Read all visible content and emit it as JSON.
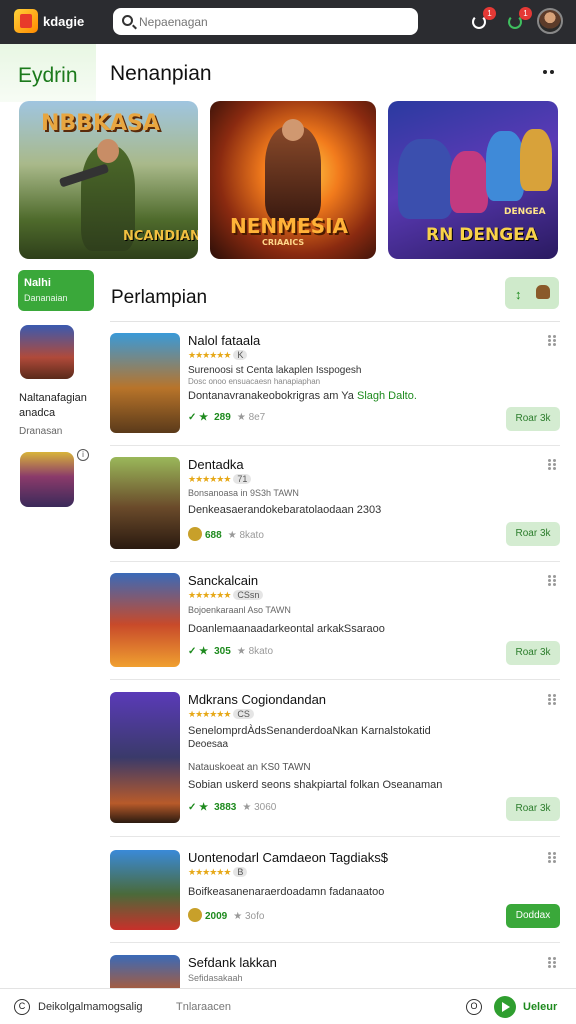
{
  "colors": {
    "topbar": "#2b2c30",
    "accent": "#3aa83a",
    "accent_light": "#d4ecd1",
    "star": "#e6a817"
  },
  "topbar": {
    "logo_text": "kdagie",
    "search_value": "",
    "search_placeholder": "Nepaenagan",
    "notif_1_count": "1",
    "notif_2_count": "1"
  },
  "featured": {
    "tab_label": "Eydrin",
    "title": "Nenanpian",
    "banners": [
      {
        "title": "NBBKASA",
        "subtitle": "NCANDIAN"
      },
      {
        "title": "NENMESIA",
        "subtitle": "CRIAAICS"
      },
      {
        "title": "RN DENGEA",
        "subtitle": "DENGEA"
      }
    ]
  },
  "sidebar": {
    "category_title": "Nalhi",
    "category_sub": "Dananaian",
    "item_name": "Naltanafagian anadca",
    "item_sub": "Dranasan"
  },
  "list": {
    "title": "Perlampian",
    "items": [
      {
        "name": "Nalol fataala",
        "rating_tag": "K",
        "subtitle": "Surenoosi st Centa lakaplen Isspogesh",
        "subtitle2": "Dosc onoo ensuacaesn hanapiaphan",
        "desc": "Dontanavranakeobokrigras am Ya",
        "desc_highlight": "Slagh Dalto.",
        "stat_a": "289",
        "stat_b": "8e7",
        "action": "Roar 3k"
      },
      {
        "name": "Dentadka",
        "rating_tag": "71",
        "subtitle": "Bonsanoasa in 9S3h TAWN",
        "desc": "Denkeasaerandokebaratolaodaan 2303",
        "stat_a": "688",
        "stat_b": "8kato",
        "action": "Roar 3k"
      },
      {
        "name": "Sanckalcain",
        "rating_tag": "CSsn",
        "subtitle": "Bojoenkaraanl Aso TAWN",
        "desc": "Doanlemaanaadarkeontal arkakSsaraoo",
        "stat_a": "305",
        "stat_b": "8kato",
        "action": "Roar 3k"
      },
      {
        "name": "Mdkrans Cogiondandan",
        "rating_tag": "CS",
        "subtitle": "SenelomprdÀdsSenanderdoaNkan Karnalstokatid",
        "subtitle2": "Deoesaa",
        "desc2": "Natauskoeat an KS0 TAWN",
        "desc": "Sobian uskerd seons shakpiartal folkan Oseanaman",
        "stat_a": "3883",
        "stat_b": "3060",
        "action": "Roar 3k"
      },
      {
        "name": "Uontenodarl Camdaeon Tagdiaks$",
        "rating_tag": "B",
        "subtitle": "Boifkeasanenaraerdoadamn fadanaatoo",
        "desc": "",
        "stat_a": "2009",
        "stat_b": "3ofo",
        "action": "Doddax"
      },
      {
        "name": "Sefdank lakkan",
        "rating_tag": "",
        "subtitle": "Sefidasakaah",
        "desc": "",
        "stat_a": "",
        "stat_b": "",
        "action": ""
      }
    ]
  },
  "bottombar": {
    "left_text": "Deikolgalmamogsalig",
    "mid_text": "Tnlaraacen",
    "right_text": "Ueleur"
  }
}
